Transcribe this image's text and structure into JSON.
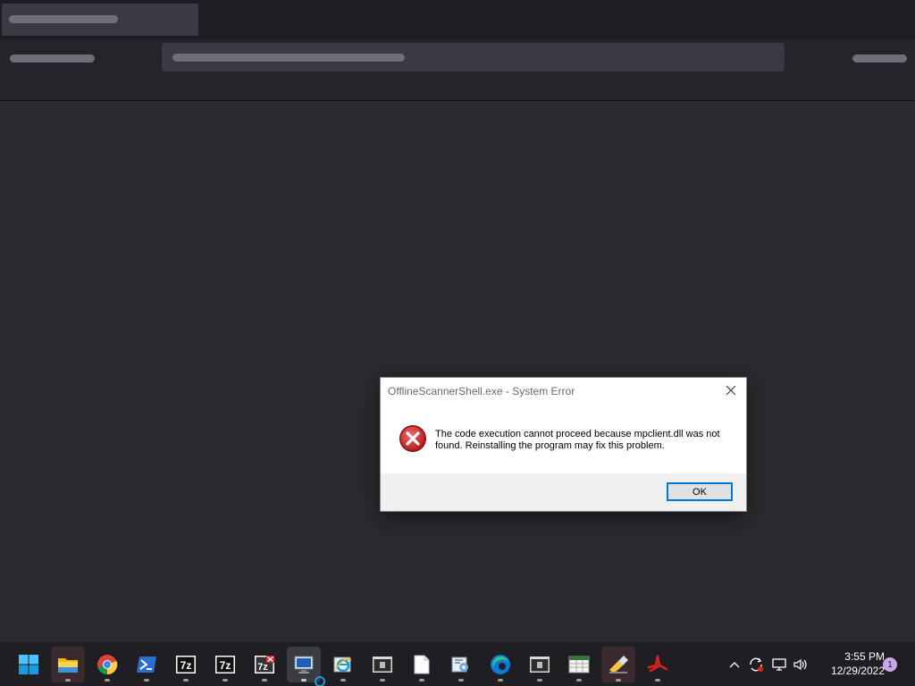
{
  "dialog": {
    "title": "OfflineScannerShell.exe - System Error",
    "message": "The code execution cannot proceed because mpclient.dll was not found. Reinstalling the program may fix this problem.",
    "ok_label": "OK",
    "icon": "error-icon"
  },
  "taskbar": {
    "items": [
      {
        "name": "start",
        "icon": "windows-start-icon"
      },
      {
        "name": "file-explorer",
        "icon": "folder-icon"
      },
      {
        "name": "chrome",
        "icon": "chrome-icon"
      },
      {
        "name": "powershell",
        "icon": "powershell-icon"
      },
      {
        "name": "7zip",
        "icon": "7zip-icon",
        "label": "7z"
      },
      {
        "name": "7zip-2",
        "icon": "7zip-icon",
        "label": "7z"
      },
      {
        "name": "7zip-x",
        "icon": "7zip-delete-icon",
        "label": "7z"
      },
      {
        "name": "remote-desktop",
        "icon": "monitor-icon"
      },
      {
        "name": "internet-explorer",
        "icon": "ie-icon"
      },
      {
        "name": "app-window-1",
        "icon": "app-window-icon"
      },
      {
        "name": "notepad",
        "icon": "document-icon"
      },
      {
        "name": "control-panel",
        "icon": "settings-icon"
      },
      {
        "name": "edge",
        "icon": "edge-icon"
      },
      {
        "name": "app-window-2",
        "icon": "app-window-icon"
      },
      {
        "name": "spreadsheet",
        "icon": "spreadsheet-icon"
      },
      {
        "name": "paint",
        "icon": "paint-icon"
      },
      {
        "name": "pdf-tool",
        "icon": "acrobat-icon"
      }
    ]
  },
  "tray": {
    "time": "3:55 PM",
    "date": "12/29/2022",
    "notification_count": "1"
  },
  "colors": {
    "desktop_bg": "#2a2a30",
    "taskbar_bg": "#1f1f23",
    "error_red": "#c62828",
    "accent_blue": "#0078d4"
  }
}
